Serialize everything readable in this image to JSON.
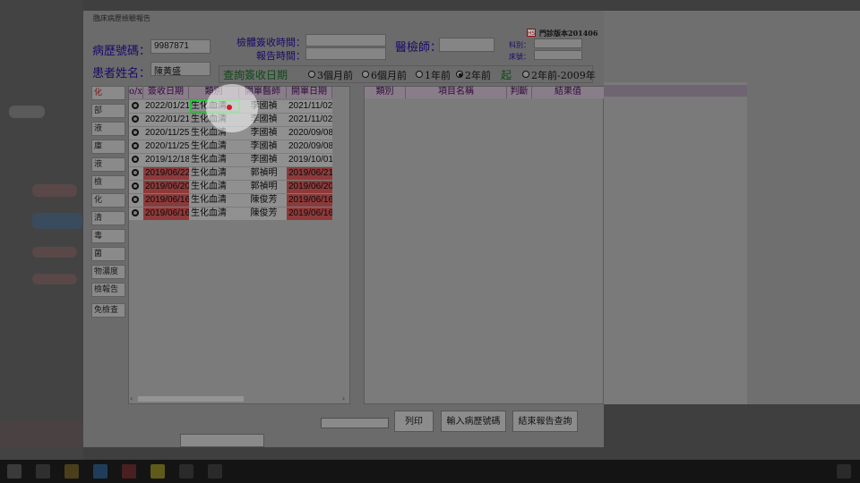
{
  "window": {
    "title": "臨床病歷檢驗報告"
  },
  "header": {
    "chart_no_label": "病歷號碼：",
    "chart_no": "9987871",
    "patient_label": "患者姓名：",
    "patient_name": "陳黃盛",
    "specimen_time_label": "檢體簽收時間：",
    "report_time_label": "報告時間：",
    "specimen_time": "",
    "report_time": "",
    "examiner_label": "醫檢師：",
    "examiner": "",
    "version": "門診版本201406",
    "version_badge": "HS",
    "dept_label": "科別：",
    "bed_label": "床號：",
    "dept": "",
    "bed": ""
  },
  "query": {
    "label": "查詢簽收日期",
    "options": [
      "3個月前",
      "6個月前",
      "1年前",
      "2年前"
    ],
    "selected_index": 3,
    "start_label": "起",
    "range_option": "2年前-2009年"
  },
  "sidebar": {
    "items": [
      "化",
      "部",
      "液",
      "庫",
      "液",
      "檢",
      "化",
      "清",
      "毒",
      "菌",
      "物濃度",
      "檢報告",
      "免檢查"
    ]
  },
  "left_table": {
    "columns": [
      "o/x",
      "簽收日期",
      "類別",
      "開單醫師",
      "開單日期"
    ],
    "rows": [
      {
        "mark": "O",
        "date": "2022/01/21",
        "type": "生化血清",
        "doctor": "李國禎",
        "order_date": "2021/11/02",
        "flagged": false
      },
      {
        "mark": "O",
        "date": "2022/01/21",
        "type": "生化血清",
        "doctor": "李國禎",
        "order_date": "2021/11/02",
        "flagged": false
      },
      {
        "mark": "O",
        "date": "2020/11/25",
        "type": "生化血清",
        "doctor": "李國禎",
        "order_date": "2020/09/08",
        "flagged": false
      },
      {
        "mark": "O",
        "date": "2020/11/25",
        "type": "生化血清",
        "doctor": "李國禎",
        "order_date": "2020/09/08",
        "flagged": false
      },
      {
        "mark": "O",
        "date": "2019/12/18",
        "type": "生化血清",
        "doctor": "李國禎",
        "order_date": "2019/10/01",
        "flagged": false
      },
      {
        "mark": "O",
        "date": "2019/06/22",
        "type": "生化血清",
        "doctor": "郭禎明",
        "order_date": "2019/06/21",
        "flagged": true
      },
      {
        "mark": "O",
        "date": "2019/06/20",
        "type": "生化血清",
        "doctor": "郭禎明",
        "order_date": "2019/06/20",
        "flagged": true
      },
      {
        "mark": "O",
        "date": "2019/06/16",
        "type": "生化血清",
        "doctor": "陳俊芳",
        "order_date": "2019/06/16",
        "flagged": true
      },
      {
        "mark": "O",
        "date": "2019/06/16",
        "type": "生化血清",
        "doctor": "陳俊芳",
        "order_date": "2019/06/16",
        "flagged": true
      }
    ]
  },
  "right_table": {
    "columns": [
      "類別",
      "項目名稱",
      "判斷",
      "結果值"
    ]
  },
  "buttons": {
    "print": "列印",
    "enter_chart": "輸入病歷號碼",
    "end_query": "結束報告查詢"
  },
  "colors": {
    "flag_red": "#8e3a3a",
    "highlight_green": "#27c23b",
    "cursor_red": "#d41b1b"
  }
}
